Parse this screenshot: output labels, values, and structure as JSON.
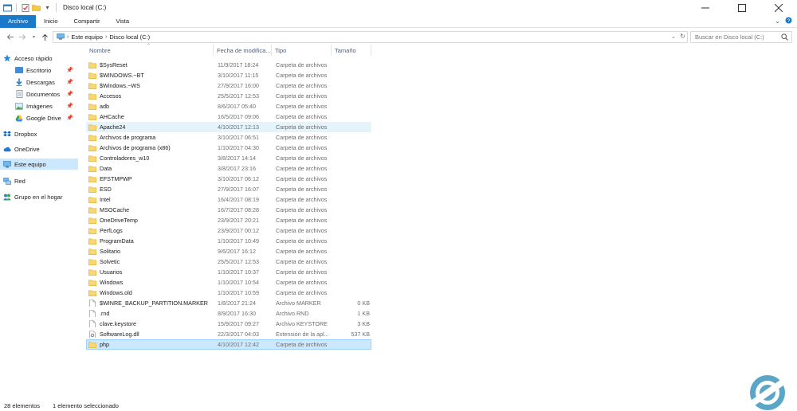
{
  "window": {
    "title": "Disco local (C:)",
    "controls": [
      "minimize-icon",
      "maximize-icon",
      "close-icon"
    ]
  },
  "ribbon": {
    "tabs": [
      {
        "label": "Archivo",
        "active": true
      },
      {
        "label": "Inicio",
        "active": false
      },
      {
        "label": "Compartir",
        "active": false
      },
      {
        "label": "Vista",
        "active": false
      }
    ],
    "accent": "#1979ca"
  },
  "address": {
    "crumbs": [
      "Este equipo",
      "Disco local (C:)"
    ]
  },
  "search": {
    "placeholder": "Buscar en Disco local (C:)"
  },
  "nav": {
    "items": [
      {
        "label": "Acceso rápido",
        "icon": "star-icon",
        "pinned": false,
        "selected": false
      },
      {
        "label": "Escritorio",
        "icon": "desktop-icon",
        "pinned": true,
        "selected": false
      },
      {
        "label": "Descargas",
        "icon": "download-icon",
        "pinned": true,
        "selected": false
      },
      {
        "label": "Documentos",
        "icon": "documents-icon",
        "pinned": true,
        "selected": false
      },
      {
        "label": "Imágenes",
        "icon": "images-icon",
        "pinned": true,
        "selected": false
      },
      {
        "label": "Google Drive",
        "icon": "google-drive-icon",
        "pinned": true,
        "selected": false
      },
      {
        "label": "Dropbox",
        "icon": "dropbox-icon",
        "pinned": false,
        "selected": false
      },
      {
        "label": "OneDrive",
        "icon": "onedrive-icon",
        "pinned": false,
        "selected": false
      },
      {
        "label": "Este equipo",
        "icon": "computer-icon",
        "pinned": false,
        "selected": true
      },
      {
        "label": "Red",
        "icon": "network-icon",
        "pinned": false,
        "selected": false
      },
      {
        "label": "Grupo en el hogar",
        "icon": "homegroup-icon",
        "pinned": false,
        "selected": false
      }
    ]
  },
  "columns": {
    "name": "Nombre",
    "date": "Fecha de modifica...",
    "type": "Tipo",
    "size": "Tamaño"
  },
  "files": [
    {
      "name": "$SysReset",
      "date": "11/9/2017 18:24",
      "type": "Carpeta de archivos",
      "size": "",
      "kind": "folder",
      "state": ""
    },
    {
      "name": "$WINDOWS.~BT",
      "date": "3/10/2017 11:15",
      "type": "Carpeta de archivos",
      "size": "",
      "kind": "folder",
      "state": ""
    },
    {
      "name": "$Windows.~WS",
      "date": "27/9/2017 16:00",
      "type": "Carpeta de archivos",
      "size": "",
      "kind": "folder",
      "state": ""
    },
    {
      "name": "Accesos",
      "date": "25/5/2017 12:53",
      "type": "Carpeta de archivos",
      "size": "",
      "kind": "folder",
      "state": ""
    },
    {
      "name": "adb",
      "date": "8/6/2017 05:40",
      "type": "Carpeta de archivos",
      "size": "",
      "kind": "folder",
      "state": ""
    },
    {
      "name": "AHCache",
      "date": "16/5/2017 09:06",
      "type": "Carpeta de archivos",
      "size": "",
      "kind": "folder",
      "state": ""
    },
    {
      "name": "Apache24",
      "date": "4/10/2017 12:13",
      "type": "Carpeta de archivos",
      "size": "",
      "kind": "folder",
      "state": "hover"
    },
    {
      "name": "Archivos de programa",
      "date": "3/10/2017 06:51",
      "type": "Carpeta de archivos",
      "size": "",
      "kind": "folder",
      "state": ""
    },
    {
      "name": "Archivos de programa (x86)",
      "date": "1/10/2017 04:30",
      "type": "Carpeta de archivos",
      "size": "",
      "kind": "folder",
      "state": ""
    },
    {
      "name": "Controladores_w10",
      "date": "3/8/2017 14:14",
      "type": "Carpeta de archivos",
      "size": "",
      "kind": "folder",
      "state": ""
    },
    {
      "name": "Data",
      "date": "3/8/2017 23:16",
      "type": "Carpeta de archivos",
      "size": "",
      "kind": "folder",
      "state": ""
    },
    {
      "name": "EFSTMPWP",
      "date": "3/10/2017 06:12",
      "type": "Carpeta de archivos",
      "size": "",
      "kind": "folder",
      "state": ""
    },
    {
      "name": "ESD",
      "date": "27/9/2017 16:07",
      "type": "Carpeta de archivos",
      "size": "",
      "kind": "folder",
      "state": ""
    },
    {
      "name": "Intel",
      "date": "16/4/2017 08:19",
      "type": "Carpeta de archivos",
      "size": "",
      "kind": "folder",
      "state": ""
    },
    {
      "name": "MSOCache",
      "date": "16/7/2017 08:28",
      "type": "Carpeta de archivos",
      "size": "",
      "kind": "folder",
      "state": ""
    },
    {
      "name": "OneDriveTemp",
      "date": "23/9/2017 20:21",
      "type": "Carpeta de archivos",
      "size": "",
      "kind": "folder",
      "state": ""
    },
    {
      "name": "PerfLogs",
      "date": "23/9/2017 00:12",
      "type": "Carpeta de archivos",
      "size": "",
      "kind": "folder",
      "state": ""
    },
    {
      "name": "ProgramData",
      "date": "1/10/2017 10:49",
      "type": "Carpeta de archivos",
      "size": "",
      "kind": "folder",
      "state": ""
    },
    {
      "name": "Solitario",
      "date": "9/6/2017 16:12",
      "type": "Carpeta de archivos",
      "size": "",
      "kind": "folder",
      "state": ""
    },
    {
      "name": "Solvetic",
      "date": "25/5/2017 12:53",
      "type": "Carpeta de archivos",
      "size": "",
      "kind": "folder",
      "state": ""
    },
    {
      "name": "Usuarios",
      "date": "1/10/2017 10:37",
      "type": "Carpeta de archivos",
      "size": "",
      "kind": "folder",
      "state": ""
    },
    {
      "name": "Windows",
      "date": "1/10/2017 10:54",
      "type": "Carpeta de archivos",
      "size": "",
      "kind": "folder",
      "state": ""
    },
    {
      "name": "Windows.old",
      "date": "1/10/2017 10:59",
      "type": "Carpeta de archivos",
      "size": "",
      "kind": "folder",
      "state": ""
    },
    {
      "name": "$WINRE_BACKUP_PARTITION.MARKER",
      "date": "1/8/2017 21:24",
      "type": "Archivo MARKER",
      "size": "0 KB",
      "kind": "file",
      "state": ""
    },
    {
      "name": ".rnd",
      "date": "8/9/2017 16:30",
      "type": "Archivo RND",
      "size": "1 KB",
      "kind": "file",
      "state": ""
    },
    {
      "name": "clave.keystore",
      "date": "15/9/2017 09:27",
      "type": "Archivo KEYSTORE",
      "size": "3 KB",
      "kind": "file",
      "state": ""
    },
    {
      "name": "SoftwareLog.dll",
      "date": "22/3/2017 04:03",
      "type": "Extensión de la apl...",
      "size": "537 KB",
      "kind": "dll",
      "state": ""
    },
    {
      "name": "php",
      "date": "4/10/2017 12:42",
      "type": "Carpeta de archivos",
      "size": "",
      "kind": "folder",
      "state": "sel"
    }
  ],
  "status": {
    "count": "28 elementos",
    "selection": "1 elemento seleccionado"
  }
}
